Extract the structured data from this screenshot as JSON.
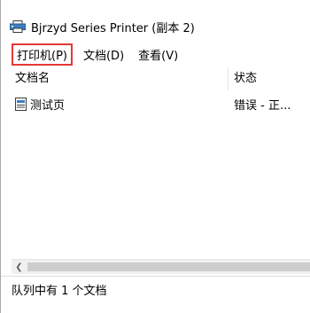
{
  "window": {
    "title": "Bjrzyd Series Printer (副本 2)"
  },
  "menu": {
    "items": [
      {
        "label": "打印机(P)",
        "highlighted": true
      },
      {
        "label": "文档(D)",
        "highlighted": false
      },
      {
        "label": "查看(V)",
        "highlighted": false
      }
    ]
  },
  "list": {
    "columns": [
      "文档名",
      "状态"
    ],
    "rows": [
      {
        "name": "测试页",
        "status": "错误 - 正..."
      }
    ]
  },
  "statusbar": {
    "text": "队列中有 1 个文档"
  },
  "colors": {
    "highlight_border": "#e53935"
  }
}
